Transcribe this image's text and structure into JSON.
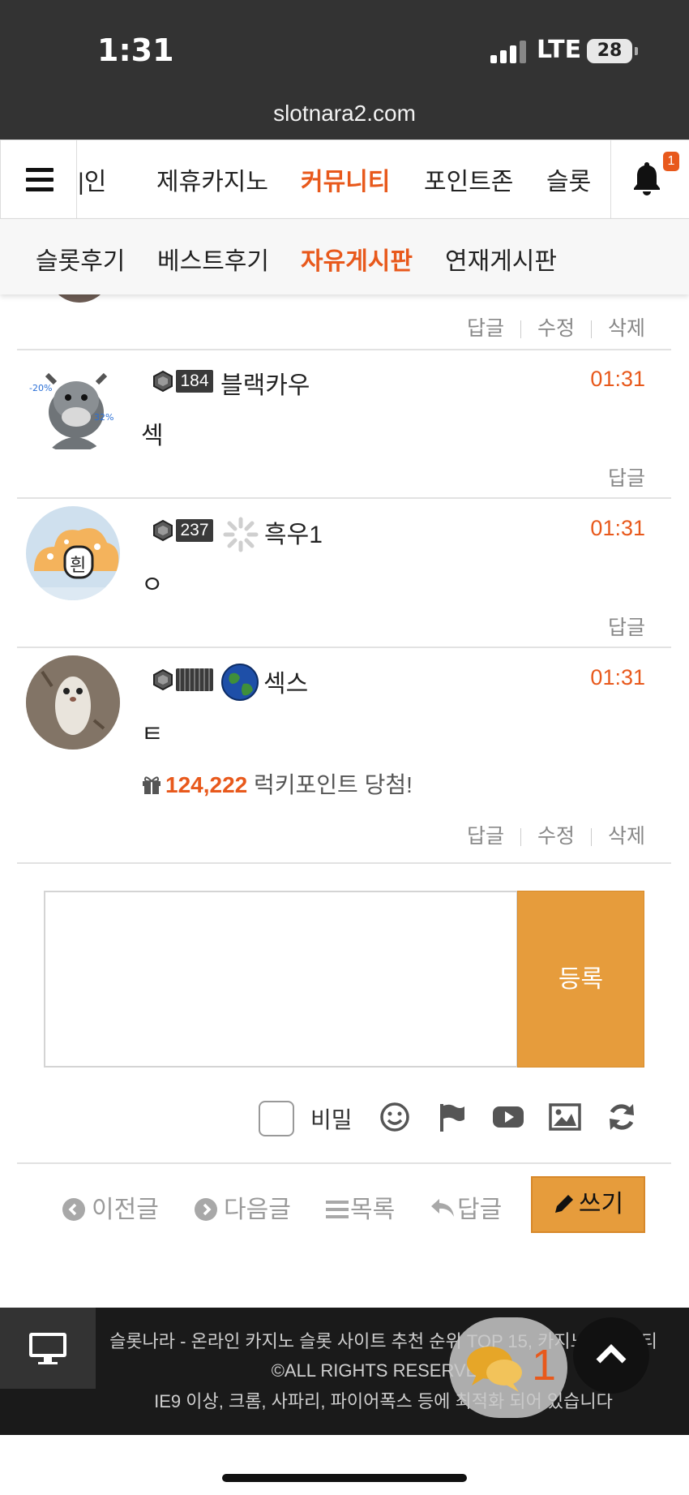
{
  "status": {
    "time": "1:31",
    "network": "LTE",
    "battery": "28"
  },
  "browser": {
    "url": "slotnara2.com"
  },
  "nav": {
    "items": [
      "|인",
      "제휴카지노",
      "커뮤니티",
      "포인트존",
      "슬롯"
    ],
    "active_index": 2,
    "notification_count": "1"
  },
  "subnav": {
    "items": [
      "슬롯후기",
      "베스트후기",
      "자유게시판",
      "연재게시판"
    ],
    "active_index": 2
  },
  "actions": {
    "reply": "답글",
    "edit": "수정",
    "delete": "삭제"
  },
  "comments": [
    {
      "level": "184",
      "nickname": "블랙카우",
      "time": "01:31",
      "body": "섹",
      "avatar_text": "-20%  32%"
    },
    {
      "level": "237",
      "nickname": "흑우1",
      "time": "01:31",
      "body": "ㅇ"
    },
    {
      "level": "",
      "nickname": "섹스",
      "time": "01:31",
      "body": "ㅌ",
      "lucky_amount": "124,222",
      "lucky_text": "럭키포인트 당첨!"
    }
  ],
  "form": {
    "submit_label": "등록",
    "secret_label": "비밀"
  },
  "bottom_nav": {
    "prev": "이전글",
    "next": "다음글",
    "list": "목록",
    "reply": "답글",
    "write": "쓰기"
  },
  "footer": {
    "line1": "슬롯나라 - 온라인 카지노 슬롯 사이트 추천 순위 TOP 15, 카지노 커뮤니티 ©ALL RIGHTS RESERVED.",
    "line2": "IE9 이상, 크롬, 사파리, 파이어폭스 등에 최적화 되어 있습니다",
    "chat_count": "1"
  },
  "colors": {
    "accent": "#e8591c",
    "button": "#e69c3c",
    "dark": "#333333"
  }
}
